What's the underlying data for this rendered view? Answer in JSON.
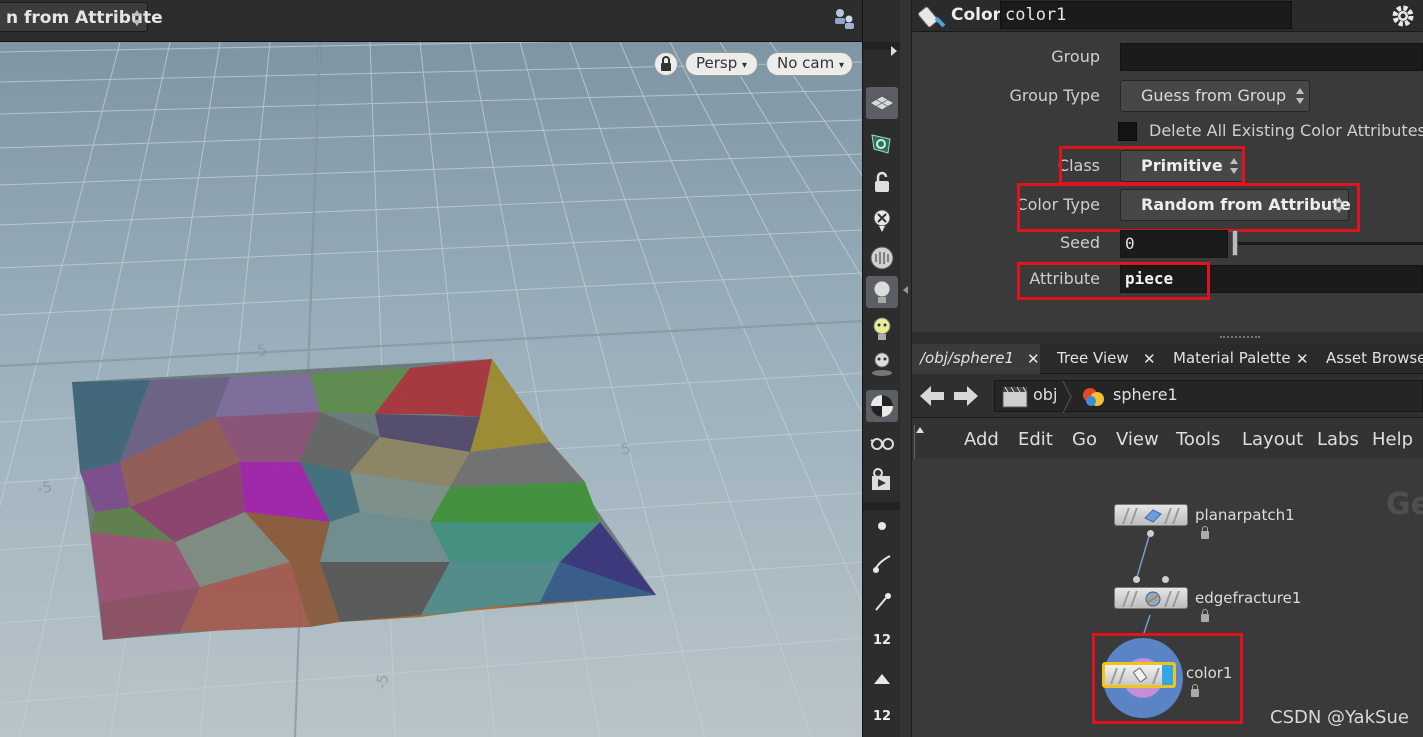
{
  "viewport": {
    "mode_label": "n from Attribute",
    "camera_view": "Persp",
    "camera_name": "No cam",
    "grid_labels": [
      "5",
      "-5",
      "5",
      "-5"
    ]
  },
  "side_toolbar": {
    "numbers": [
      "12",
      "12"
    ]
  },
  "params": {
    "node_type": "Color",
    "node_name": "color1",
    "group_label": "Group",
    "group_value": "",
    "group_type_label": "Group Type",
    "group_type_value": "Guess from Group",
    "delete_attrs_label": "Delete All Existing Color Attributes",
    "class_label": "Class",
    "class_value": "Primitive",
    "color_type_label": "Color Type",
    "color_type_value": "Random from Attribute",
    "seed_label": "Seed",
    "seed_value": "0",
    "attribute_label": "Attribute",
    "attribute_value": "piece"
  },
  "tabs": [
    {
      "label": "/obj/sphere1"
    },
    {
      "label": "Tree View"
    },
    {
      "label": "Material Palette"
    },
    {
      "label": "Asset Browser"
    }
  ],
  "path": {
    "root": "obj",
    "current": "sphere1"
  },
  "menu": [
    "Add",
    "Edit",
    "Go",
    "View",
    "Tools",
    "Layout",
    "Labs",
    "Help"
  ],
  "network": {
    "context_watermark": "Ge",
    "nodes": [
      {
        "name": "planarpatch1"
      },
      {
        "name": "edgefracture1"
      },
      {
        "name": "color1"
      }
    ]
  },
  "watermark": "CSDN @YakSue",
  "colors": {
    "highlight": "#e0141e",
    "grid_bg": "#9fb1bb"
  }
}
